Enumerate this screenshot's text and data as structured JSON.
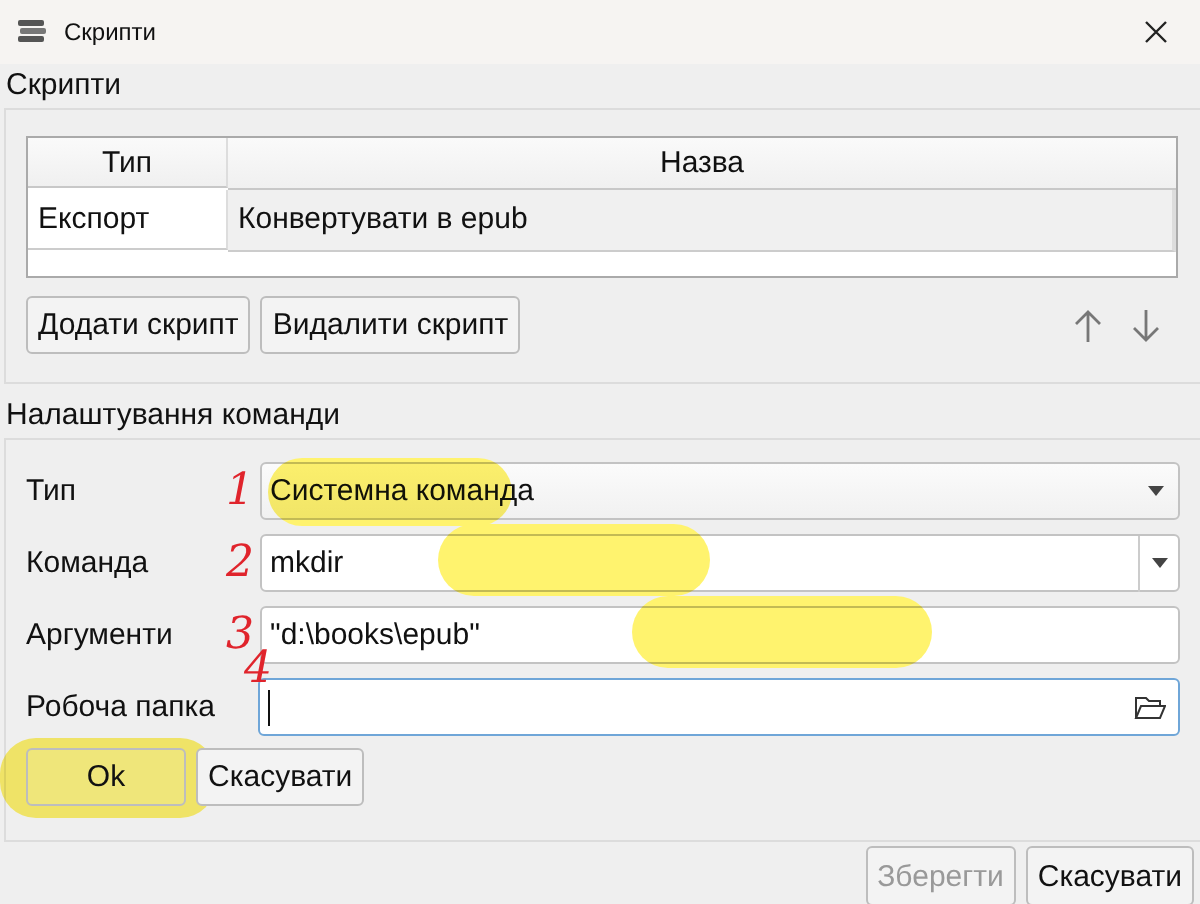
{
  "window": {
    "title": "Скрипти"
  },
  "scripts": {
    "title": "Скрипти",
    "table": {
      "columns": [
        "Тип",
        "Назва"
      ],
      "rows": [
        {
          "cells": [
            "Експорт",
            "Конвертувати в epub"
          ],
          "selected": true
        }
      ]
    },
    "buttons": [
      "Додати скрипт",
      "Видалити скрипт"
    ]
  },
  "command": {
    "title": "Налаштування команди",
    "fields": [
      {
        "kind": "combo",
        "label": "Тип",
        "value": "Системна команда",
        "marker": "1",
        "highlighted": true
      },
      {
        "kind": "editcombo",
        "label": "Команда",
        "value": "mkdir",
        "marker": "2",
        "highlighted": true
      },
      {
        "kind": "text",
        "label": "Аргументи",
        "value": "\"d:\\books\\epub\"",
        "marker": "3",
        "highlighted": true
      },
      {
        "kind": "folder",
        "label": "Робоча папка",
        "marker": "4",
        "focused": true
      }
    ],
    "buttons": [
      {
        "label": "Ok",
        "highlighted": true
      },
      {
        "label": "Скасувати",
        "highlighted": false
      }
    ]
  },
  "footer_buttons": [
    {
      "label": "Зберегти",
      "disabled": true
    },
    {
      "label": "Скасувати",
      "disabled": false
    }
  ]
}
